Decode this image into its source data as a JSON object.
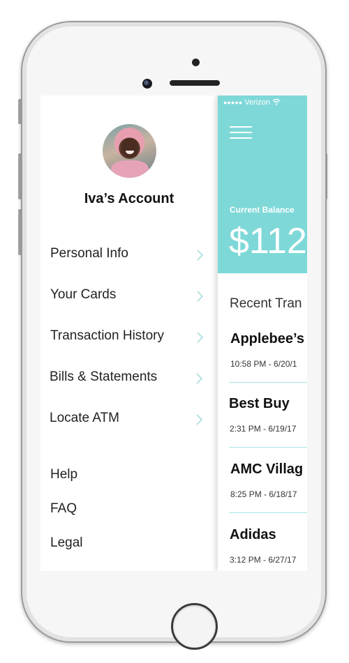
{
  "account": {
    "name": "Iva’s Account"
  },
  "menu": {
    "items": [
      {
        "label": "Personal Info"
      },
      {
        "label": "Your Cards"
      },
      {
        "label": "Transaction History"
      },
      {
        "label": "Bills & Statements"
      },
      {
        "label": "Locate ATM"
      }
    ],
    "secondary": [
      {
        "label": "Help"
      },
      {
        "label": "FAQ"
      },
      {
        "label": "Legal"
      }
    ]
  },
  "status_bar": {
    "signal_dots": "●●●●●",
    "carrier": "Verizon"
  },
  "balance": {
    "label": "Current Balance",
    "value": "$112"
  },
  "transactions": {
    "title": "Recent Tran",
    "items": [
      {
        "name": "Applebee’s",
        "time": "10:58 PM - 6/20/1"
      },
      {
        "name": "Best Buy",
        "time": "2:31 PM - 6/19/17"
      },
      {
        "name": "AMC Villag",
        "time": "8:25 PM - 6/18/17"
      },
      {
        "name": "Adidas",
        "time": "3:12 PM - 6/27/17"
      }
    ]
  },
  "colors": {
    "accent": "#7fd8d8",
    "chevron": "#a8dede",
    "divider": "#a9e3e3"
  },
  "icons": {
    "menu": "hamburger-icon",
    "chevron": "chevron-right-icon",
    "wifi": "wifi-icon"
  }
}
